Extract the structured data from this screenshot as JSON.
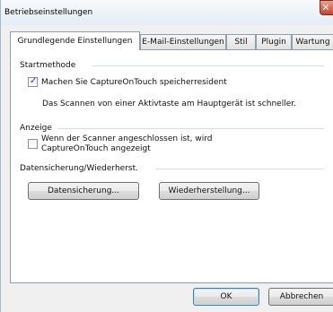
{
  "window": {
    "title": "Betriebseinstellungen"
  },
  "tabs": [
    {
      "label": "Grundlegende Einstellungen",
      "active": true
    },
    {
      "label": "E-Mail-Einstellungen",
      "active": false
    },
    {
      "label": "Stil",
      "active": false
    },
    {
      "label": "Plugin",
      "active": false
    },
    {
      "label": "Wartung",
      "active": false
    }
  ],
  "startmethode": {
    "title": "Startmethode",
    "checkbox_label": "Machen Sie CaptureOnTouch speicherresident",
    "checked": true,
    "hint": "Das Scannen von einer Aktivtaste am Hauptgerät ist schneller."
  },
  "anzeige": {
    "title": "Anzeige",
    "checkbox_label_line1": "Wenn der Scanner angeschlossen ist, wird",
    "checkbox_label_line2": "CaptureOnTouch angezeigt",
    "checked": false
  },
  "datensicherung": {
    "title": "Datensicherung/Wiederherst.",
    "backup_button": "Datensicherung...",
    "restore_button": "Wiederherstellung..."
  },
  "footer": {
    "ok_label": "OK",
    "cancel_label": "Abbrechen"
  }
}
